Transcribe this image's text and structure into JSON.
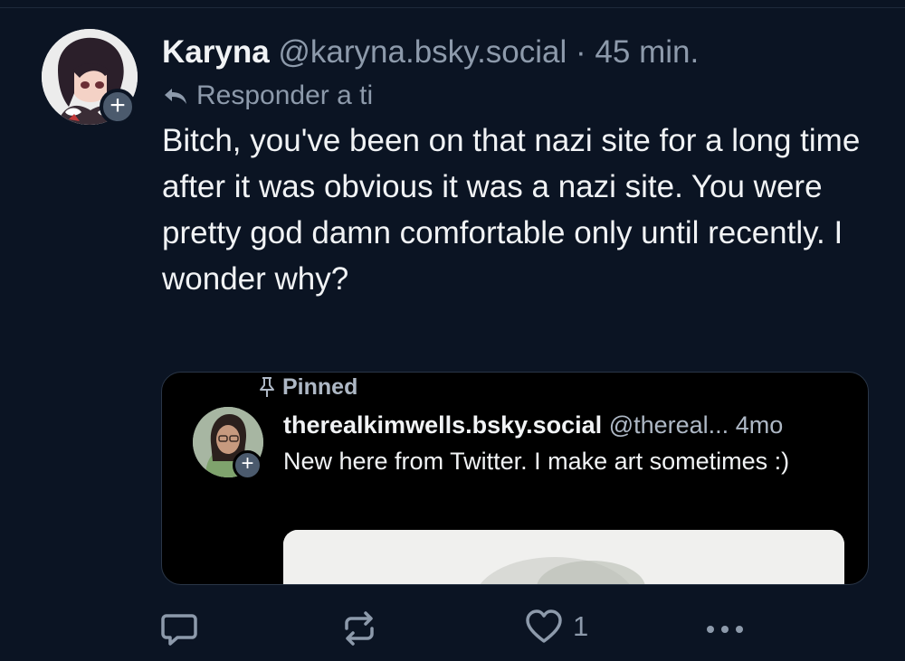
{
  "post": {
    "display_name": "Karyna",
    "handle": "@karyna.bsky.social",
    "separator": "·",
    "time": "45 min.",
    "reply_label": "Responder a ti",
    "text": "Bitch, you've been on that nazi site for a long time after it was obvious it was a nazi site. You were pretty god damn comfortable only until recently. I wonder why?"
  },
  "embed": {
    "pinned_label": "Pinned",
    "display_name": "therealkimwells.bsky.social",
    "handle": "@thereal...",
    "time": "4mo",
    "text": "New here from Twitter. I make art sometimes :)"
  },
  "actions": {
    "like_count": "1"
  },
  "icons": {
    "avatar": "anime-avatar",
    "follow": "plus-icon",
    "reply_indicator": "reply-arrow-icon",
    "pin": "pin-icon",
    "reply": "comment-icon",
    "repost": "repost-icon",
    "like": "heart-icon",
    "more": "ellipsis-icon"
  },
  "colors": {
    "background": "#0b1423",
    "muted_text": "#8d9aab",
    "embed_background": "#000000",
    "badge": "#4b5a6d"
  }
}
